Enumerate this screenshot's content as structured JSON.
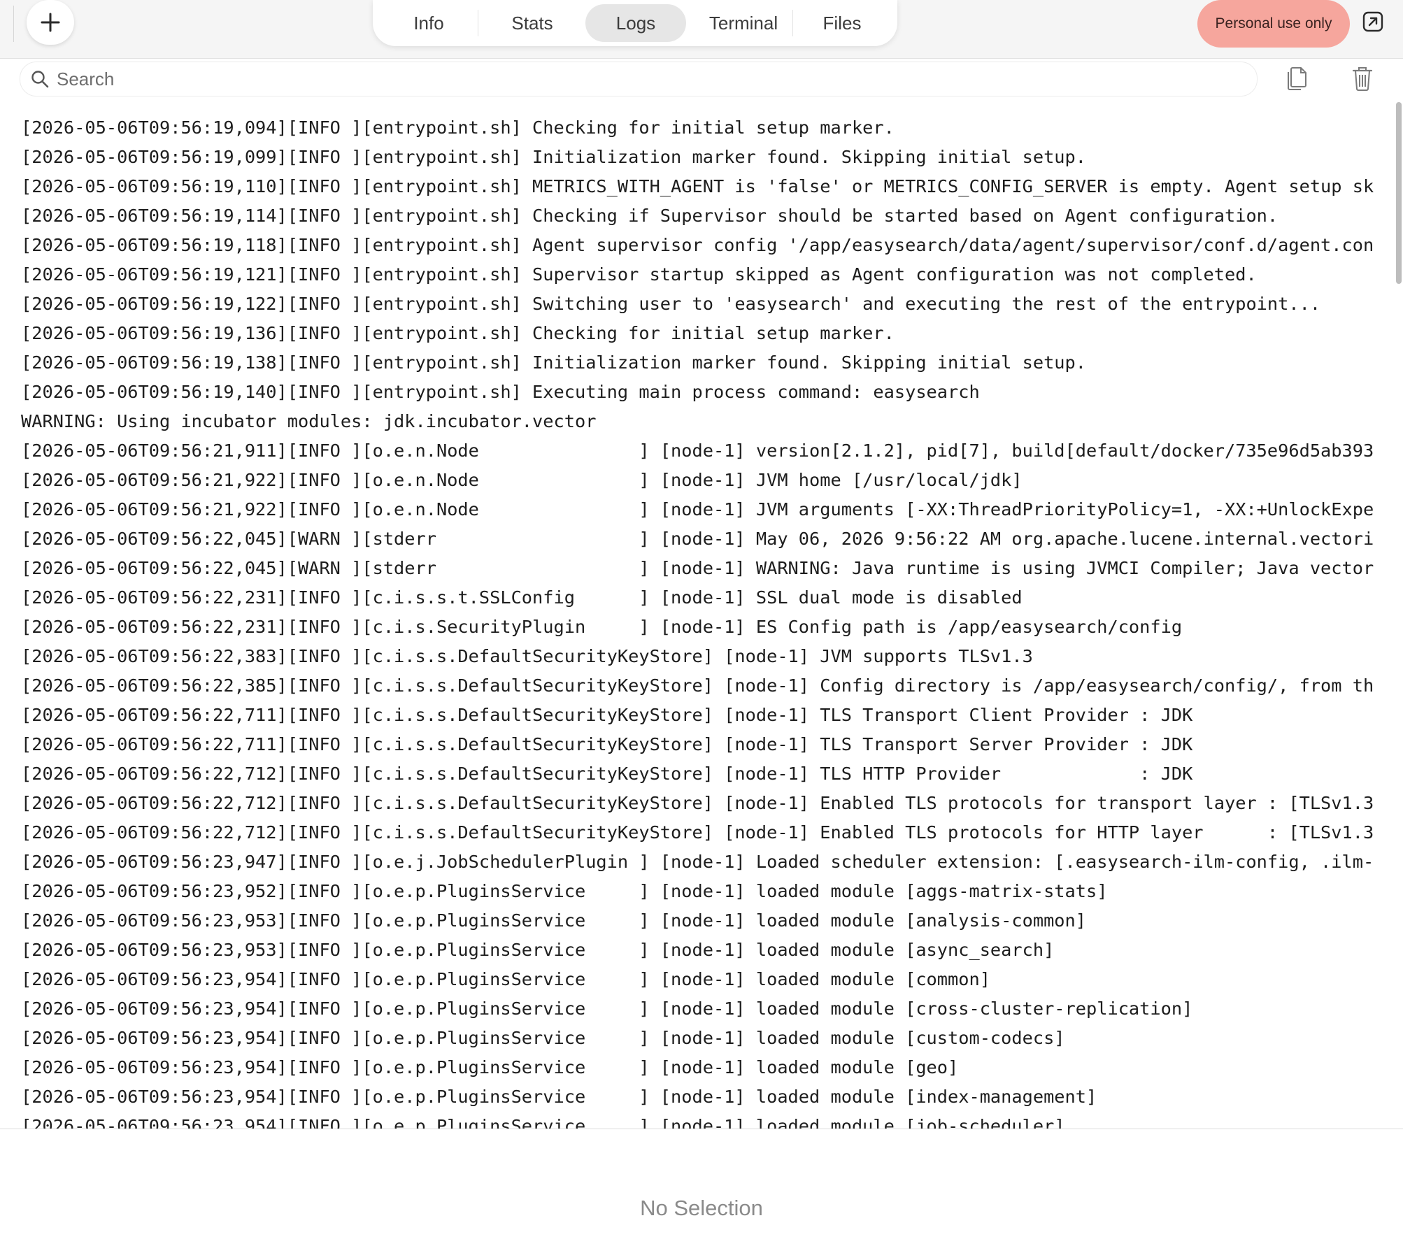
{
  "toolbar": {
    "add_icon": "plus-icon",
    "tabs": [
      {
        "label": "Info"
      },
      {
        "label": "Stats"
      },
      {
        "label": "Logs",
        "selected": true
      },
      {
        "label": "Terminal"
      },
      {
        "label": "Files"
      }
    ],
    "badge": "Personal use only",
    "badge_color": "#f6a69d",
    "open_external_icon": "open-external-icon"
  },
  "search": {
    "placeholder": "Search",
    "value": "",
    "icon": "search-icon"
  },
  "actions": {
    "copy_icon": "copy-icon",
    "clear_icon": "trash-icon"
  },
  "logs": [
    "[2026-05-06T09:56:19,094][INFO ][entrypoint.sh] Checking for initial setup marker.",
    "[2026-05-06T09:56:19,099][INFO ][entrypoint.sh] Initialization marker found. Skipping initial setup.",
    "[2026-05-06T09:56:19,110][INFO ][entrypoint.sh] METRICS_WITH_AGENT is 'false' or METRICS_CONFIG_SERVER is empty. Agent setup sk",
    "[2026-05-06T09:56:19,114][INFO ][entrypoint.sh] Checking if Supervisor should be started based on Agent configuration.",
    "[2026-05-06T09:56:19,118][INFO ][entrypoint.sh] Agent supervisor config '/app/easysearch/data/agent/supervisor/conf.d/agent.con",
    "[2026-05-06T09:56:19,121][INFO ][entrypoint.sh] Supervisor startup skipped as Agent configuration was not completed.",
    "[2026-05-06T09:56:19,122][INFO ][entrypoint.sh] Switching user to 'easysearch' and executing the rest of the entrypoint...",
    "[2026-05-06T09:56:19,136][INFO ][entrypoint.sh] Checking for initial setup marker.",
    "[2026-05-06T09:56:19,138][INFO ][entrypoint.sh] Initialization marker found. Skipping initial setup.",
    "[2026-05-06T09:56:19,140][INFO ][entrypoint.sh] Executing main process command: easysearch",
    "WARNING: Using incubator modules: jdk.incubator.vector",
    "[2026-05-06T09:56:21,911][INFO ][o.e.n.Node               ] [node-1] version[2.1.2], pid[7], build[default/docker/735e96d5ab393",
    "[2026-05-06T09:56:21,922][INFO ][o.e.n.Node               ] [node-1] JVM home [/usr/local/jdk]",
    "[2026-05-06T09:56:21,922][INFO ][o.e.n.Node               ] [node-1] JVM arguments [-XX:ThreadPriorityPolicy=1, -XX:+UnlockExpe",
    "[2026-05-06T09:56:22,045][WARN ][stderr                   ] [node-1] May 06, 2026 9:56:22 AM org.apache.lucene.internal.vectori",
    "[2026-05-06T09:56:22,045][WARN ][stderr                   ] [node-1] WARNING: Java runtime is using JVMCI Compiler; Java vector",
    "[2026-05-06T09:56:22,231][INFO ][c.i.s.s.t.SSLConfig      ] [node-1] SSL dual mode is disabled",
    "[2026-05-06T09:56:22,231][INFO ][c.i.s.SecurityPlugin     ] [node-1] ES Config path is /app/easysearch/config",
    "[2026-05-06T09:56:22,383][INFO ][c.i.s.s.DefaultSecurityKeyStore] [node-1] JVM supports TLSv1.3",
    "[2026-05-06T09:56:22,385][INFO ][c.i.s.s.DefaultSecurityKeyStore] [node-1] Config directory is /app/easysearch/config/, from th",
    "[2026-05-06T09:56:22,711][INFO ][c.i.s.s.DefaultSecurityKeyStore] [node-1] TLS Transport Client Provider : JDK",
    "[2026-05-06T09:56:22,711][INFO ][c.i.s.s.DefaultSecurityKeyStore] [node-1] TLS Transport Server Provider : JDK",
    "[2026-05-06T09:56:22,712][INFO ][c.i.s.s.DefaultSecurityKeyStore] [node-1] TLS HTTP Provider             : JDK",
    "[2026-05-06T09:56:22,712][INFO ][c.i.s.s.DefaultSecurityKeyStore] [node-1] Enabled TLS protocols for transport layer : [TLSv1.3",
    "[2026-05-06T09:56:22,712][INFO ][c.i.s.s.DefaultSecurityKeyStore] [node-1] Enabled TLS protocols for HTTP layer      : [TLSv1.3",
    "[2026-05-06T09:56:23,947][INFO ][o.e.j.JobSchedulerPlugin ] [node-1] Loaded scheduler extension: [.easysearch-ilm-config, .ilm-",
    "[2026-05-06T09:56:23,952][INFO ][o.e.p.PluginsService     ] [node-1] loaded module [aggs-matrix-stats]",
    "[2026-05-06T09:56:23,953][INFO ][o.e.p.PluginsService     ] [node-1] loaded module [analysis-common]",
    "[2026-05-06T09:56:23,953][INFO ][o.e.p.PluginsService     ] [node-1] loaded module [async_search]",
    "[2026-05-06T09:56:23,954][INFO ][o.e.p.PluginsService     ] [node-1] loaded module [common]",
    "[2026-05-06T09:56:23,954][INFO ][o.e.p.PluginsService     ] [node-1] loaded module [cross-cluster-replication]",
    "[2026-05-06T09:56:23,954][INFO ][o.e.p.PluginsService     ] [node-1] loaded module [custom-codecs]",
    "[2026-05-06T09:56:23,954][INFO ][o.e.p.PluginsService     ] [node-1] loaded module [geo]",
    "[2026-05-06T09:56:23,954][INFO ][o.e.p.PluginsService     ] [node-1] loaded module [index-management]",
    "[2026-05-06T09:56:23,954][INFO ][o.e.p.PluginsService     ] [node-1] loaded module [job-scheduler]"
  ],
  "detail": {
    "empty_text": "No Selection"
  }
}
